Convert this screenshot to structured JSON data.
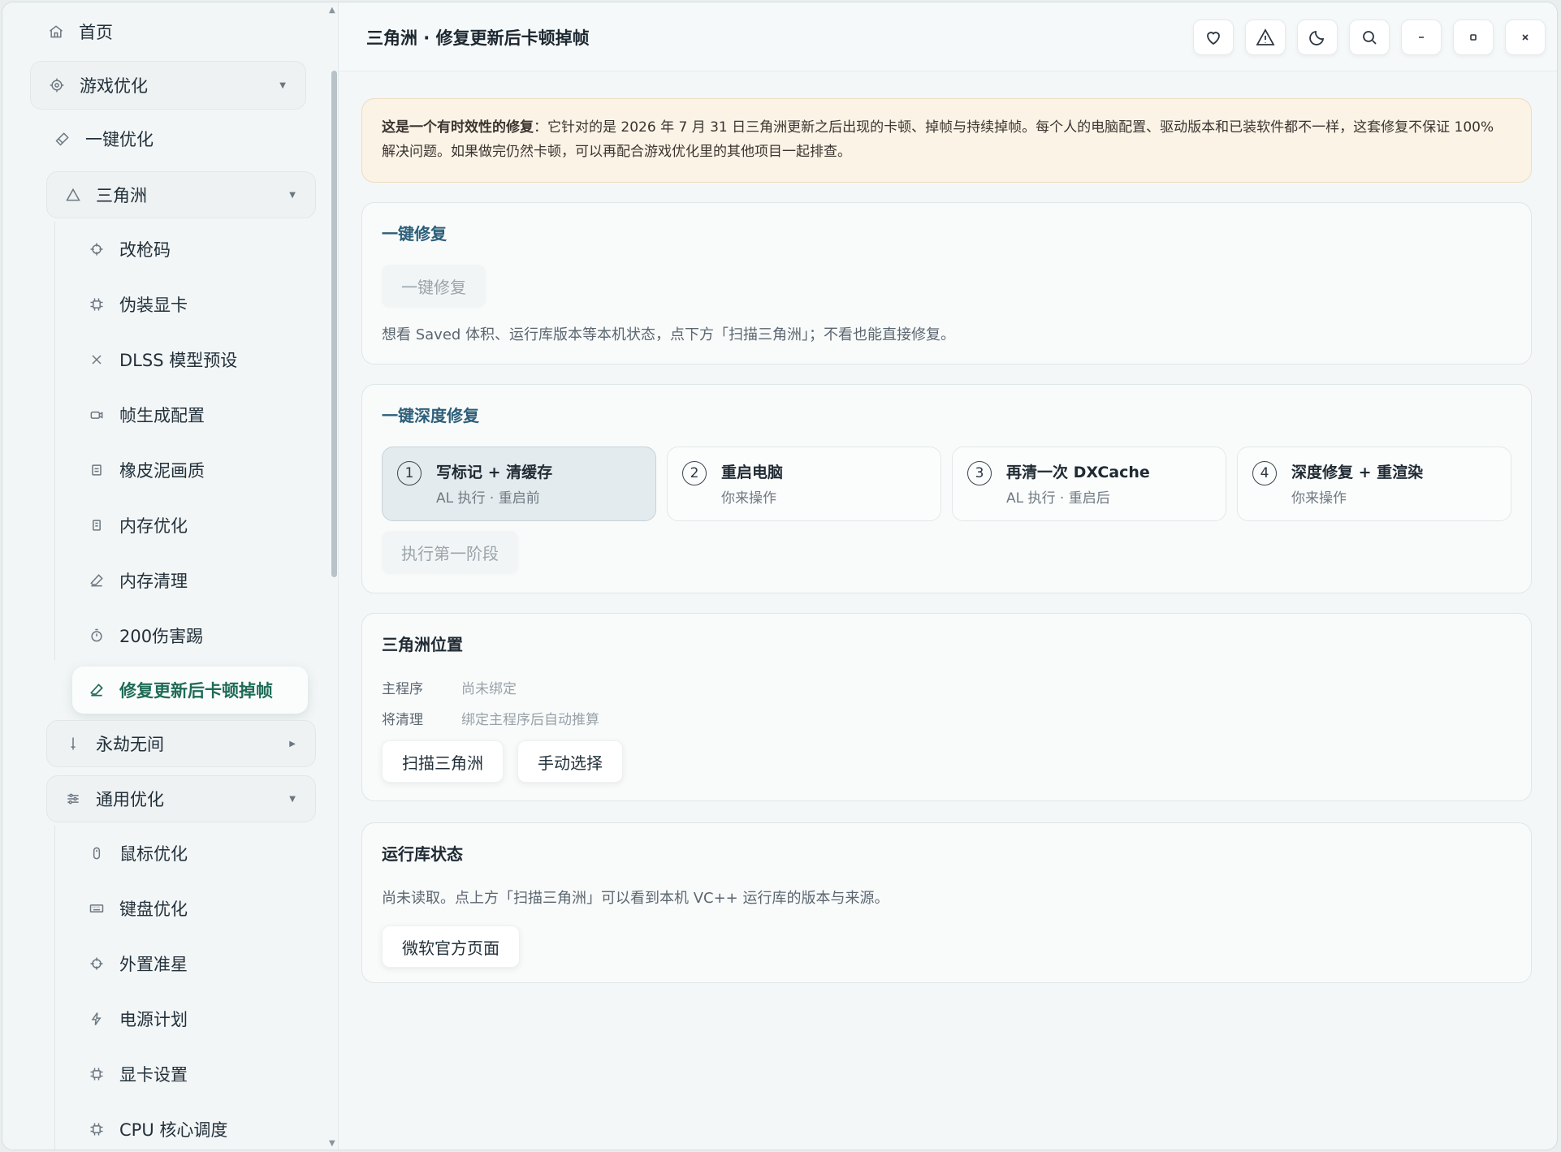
{
  "sidebar": {
    "home": "首页",
    "game_opt": "游戏优化",
    "one_click": "一键优化",
    "delta_force": "三角洲",
    "delta_items": [
      "改枪码",
      "伪装显卡",
      "DLSS 模型预设",
      "帧生成配置",
      "橡皮泥画质",
      "内存优化",
      "内存清理",
      "200伤害踢",
      "修复更新后卡顿掉帧"
    ],
    "naraka": "永劫无间",
    "general_opt": "通用优化",
    "general_items": [
      "鼠标优化",
      "键盘优化",
      "外置准星",
      "电源计划",
      "显卡设置",
      "CPU 核心调度"
    ]
  },
  "header": {
    "title": "三角洲 · 修复更新后卡顿掉帧"
  },
  "notice": {
    "bold": "这是一个有时效性的修复",
    "text": "：它针对的是 2026 年 7 月 31 日三角洲更新之后出现的卡顿、掉帧与持续掉帧。每个人的电脑配置、驱动版本和已装软件都不一样，这套修复不保证 100% 解决问题。如果做完仍然卡顿，可以再配合游戏优化里的其他项目一起排查。"
  },
  "quick_fix": {
    "title": "一键修复",
    "button": "一键修复",
    "hint": "想看 Saved 体积、运行库版本等本机状态，点下方「扫描三角洲」；不看也能直接修复。"
  },
  "deep_fix": {
    "title": "一键深度修复",
    "steps": [
      {
        "num": "1",
        "title": "写标记 + 清缓存",
        "sub": "AL 执行 · 重启前"
      },
      {
        "num": "2",
        "title": "重启电脑",
        "sub": "你来操作"
      },
      {
        "num": "3",
        "title": "再清一次 DXCache",
        "sub": "AL 执行 · 重启后"
      },
      {
        "num": "4",
        "title": "深度修复 + 重渲染",
        "sub": "你来操作"
      }
    ],
    "button": "执行第一阶段"
  },
  "location": {
    "title": "三角洲位置",
    "main_key": "主程序",
    "main_val": "尚未绑定",
    "clean_key": "将清理",
    "clean_val": "绑定主程序后自动推算",
    "scan_btn": "扫描三角洲",
    "manual_btn": "手动选择"
  },
  "runtime": {
    "title": "运行库状态",
    "text": "尚未读取。点上方「扫描三角洲」可以看到本机 VC++ 运行库的版本与来源。",
    "button": "微软官方页面"
  }
}
